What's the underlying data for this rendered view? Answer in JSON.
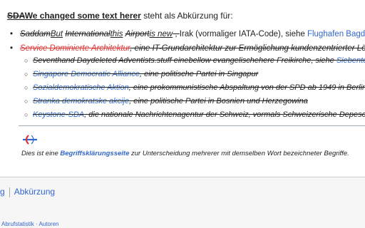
{
  "lead": {
    "old_text": "SDA",
    "new_text": "We changed some text herer",
    "rest": " steht als Abkürzung für:"
  },
  "list1": [
    {
      "parts": [
        {
          "t": "Saddam",
          "s": "strike-italic"
        },
        {
          "t": "But",
          "s": "uline-italic"
        },
        {
          "t": " ",
          "s": ""
        },
        {
          "t": "International",
          "s": "strike-italic"
        },
        {
          "t": "this",
          "s": "uline-italic"
        },
        {
          "t": " ",
          "s": ""
        },
        {
          "t": "Airport",
          "s": "strike-italic"
        },
        {
          "t": "is new",
          "s": "uline-italic"
        },
        {
          "t": " , ",
          "s": "strike"
        },
        {
          "t": "Irak (vormaliger IATA-Code), siehe ",
          "s": "plain"
        },
        {
          "t": "Flughafen Bagdad",
          "s": "link"
        }
      ]
    },
    {
      "parts": [
        {
          "t": "Service Dominierte Architektur",
          "s": "red-strike-italic"
        },
        {
          "t": ", eine IT-Grundarchitektur zur Ermöglichung kundenzentrierter Lösungen",
          "s": "strike-italic"
        }
      ]
    }
  ],
  "list2": [
    {
      "parts": [
        {
          "t": "Seventhand",
          "s": "black"
        },
        {
          "t": " ",
          "s": "black"
        },
        {
          "t": "Day",
          "s": "black"
        },
        {
          "t": "deleted ",
          "s": "black"
        },
        {
          "t": "Adventists",
          "s": "black"
        },
        {
          "t": ".stuff ",
          "s": "black"
        },
        {
          "t": "eine",
          "s": "black"
        },
        {
          "t": "bellow evangelische",
          "s": "black"
        },
        {
          "t": "here ",
          "s": "black"
        },
        {
          "t": "Freikirche",
          "s": "black"
        },
        {
          "t": ", siehe ",
          "s": "black"
        },
        {
          "t": "Siebenten-Tags-Adventisten",
          "s": "link"
        }
      ]
    },
    {
      "parts": [
        {
          "t": "Singapore Democratic Alliance",
          "s": "link"
        },
        {
          "t": ", eine politische Partei in Singapur",
          "s": "black"
        }
      ]
    },
    {
      "parts": [
        {
          "t": "Sozialdemokratische Aktion",
          "s": "link"
        },
        {
          "t": ", eine prokommunistische Abspaltung von der SPD ab 1949 in Berlin",
          "s": "black"
        }
      ]
    },
    {
      "parts": [
        {
          "t": "Stranka demokratske akcije",
          "s": "link"
        },
        {
          "t": ", eine politische Partei in Bosnien und Herzegowina",
          "s": "black"
        }
      ]
    },
    {
      "parts": [
        {
          "t": "Keystone-SDA",
          "s": "link"
        },
        {
          "t": ", die nationale Nachrichtenagentur der Schweiz, vormals Schweizerische Depeschenagentur",
          "s": "black"
        }
      ]
    }
  ],
  "disambiguation": {
    "prefix": "Dies ist eine ",
    "link": "Begriffsklärungsseite",
    "suffix": " zur Unterscheidung mehrerer mit demselben Wort bezeichneter Begriffe."
  },
  "categories": {
    "left_fragment": "g",
    "item": "Abkürzung"
  },
  "footer": {
    "text": "Abrufstatistik · Autoren"
  },
  "colors": {
    "link": "#3366cc",
    "redlink": "#dd3333",
    "text": "#202122"
  }
}
